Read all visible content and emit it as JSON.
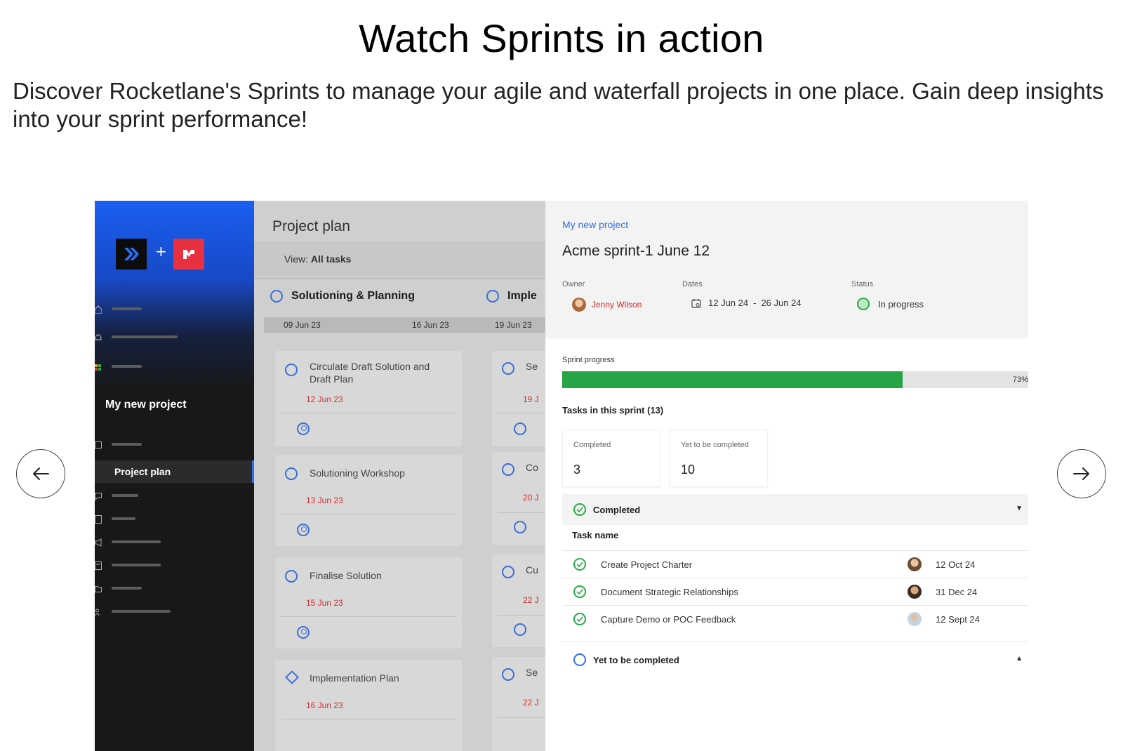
{
  "page": {
    "headline": "Watch Sprints in action",
    "subtext": "Discover Rocketlane's Sprints to manage your agile and waterfall projects in one place. Gain deep insights into your sprint performance!"
  },
  "carousel": {
    "prev_icon": "arrow-left-icon",
    "next_icon": "arrow-right-icon"
  },
  "sidebar": {
    "logo_left": "rocketlane",
    "logo_plus": "+",
    "project_name": "My new project",
    "active_item": "Project plan"
  },
  "plan": {
    "title": "Project plan",
    "view_prefix": "View:",
    "view_value": "All tasks",
    "phases": [
      "Solutioning & Planning",
      "Imple"
    ],
    "date_labels": [
      "09 Jun 23",
      "16 Jun 23",
      "19 Jun 23"
    ],
    "cards": [
      {
        "name": "Circulate Draft Solution and Draft Plan",
        "date": "12 Jun 23"
      },
      {
        "name": "Solutioning Workshop",
        "date": "13 Jun 23"
      },
      {
        "name": "Finalise Solution",
        "date": "15 Jun 23"
      },
      {
        "name": "Implementation Plan",
        "date": "16 Jun 23"
      }
    ],
    "cards_right": [
      {
        "name": "Se",
        "date": "19 J"
      },
      {
        "name": "Co",
        "date": "20 J"
      },
      {
        "name": "Cu",
        "date": "22 J"
      },
      {
        "name": "Se",
        "date": "22 J"
      }
    ]
  },
  "detail": {
    "breadcrumb": "My new project",
    "sprint_title": "Acme sprint-1 June 12",
    "owner_label": "Owner",
    "owner_name": "Jenny Wilson",
    "dates_label": "Dates",
    "dates_start": "12 Jun 24",
    "dates_sep": "-",
    "dates_end": "26 Jun 24",
    "status_label": "Status",
    "status_value": "In progress",
    "progress_label": "Sprint progress",
    "progress_percent": 73,
    "progress_text": "73%",
    "tasks_heading": "Tasks in this sprint (13)",
    "stats": [
      {
        "label": "Completed",
        "value": "3"
      },
      {
        "label": "Yet to be completed",
        "value": "10"
      }
    ],
    "completed_group": "Completed",
    "column_task_name": "Task name",
    "tasks": [
      {
        "name": "Create Project Charter",
        "date": "12 Oct 24"
      },
      {
        "name": "Document Strategic Relationships",
        "date": "31 Dec 24"
      },
      {
        "name": "Capture Demo or POC Feedback",
        "date": "12 Sept 24"
      }
    ],
    "pending_group": "Yet to be completed"
  },
  "colors": {
    "accent_blue": "#2f6ef0",
    "progress_green": "#26a446",
    "overdue_red": "#d12d2d",
    "brand_red": "#e8303f"
  }
}
